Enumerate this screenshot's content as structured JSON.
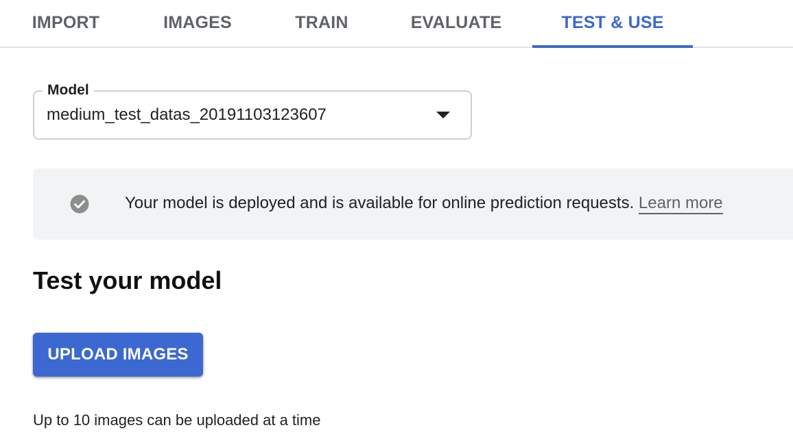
{
  "tabs": [
    {
      "label": "IMPORT",
      "active": false
    },
    {
      "label": "IMAGES",
      "active": false
    },
    {
      "label": "TRAIN",
      "active": false
    },
    {
      "label": "EVALUATE",
      "active": false
    },
    {
      "label": "TEST & USE",
      "active": true
    }
  ],
  "model_select": {
    "label": "Model",
    "value": "medium_test_datas_20191103123607",
    "icon": "chevron-down-icon"
  },
  "banner": {
    "icon": "check-circle-icon",
    "message": "Your model is deployed and is available for online prediction requests.",
    "link_label": "Learn more"
  },
  "test_section": {
    "heading": "Test your model",
    "upload_button_label": "UPLOAD IMAGES",
    "hint": "Up to 10 images can be uploaded at a time"
  },
  "colors": {
    "accent": "#3c68d1",
    "tab_inactive": "#5f6368",
    "banner_bg": "#f1f3f4",
    "check_icon": "#8a8f8c"
  }
}
